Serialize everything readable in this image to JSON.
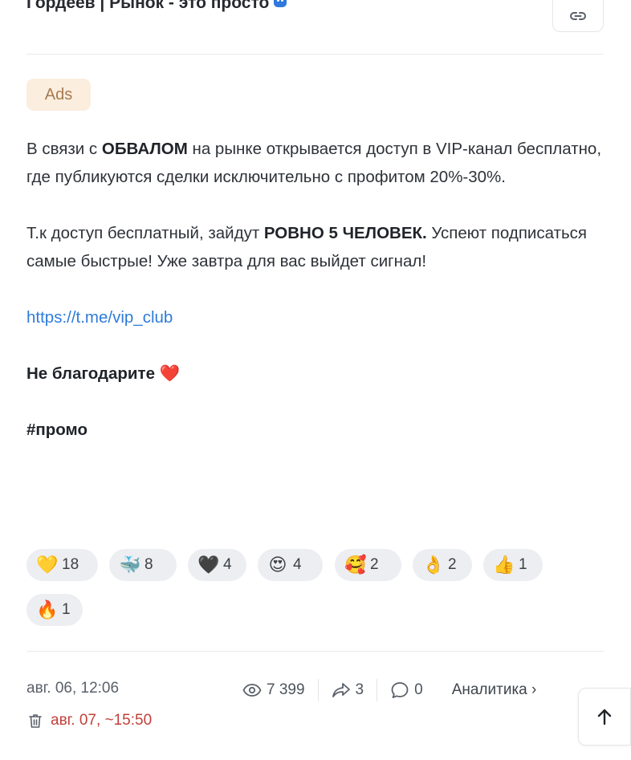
{
  "channel": {
    "title": "Гордеев | Рынок - это просто"
  },
  "ads_badge": "Ads",
  "post": {
    "p1_a": "В связи с ",
    "p1_b": "ОБВАЛОМ",
    "p1_c": " на рынке открывается доступ в VIP-канал бесплатно, где публикуются сделки исключительно с профитом 20%-30%.",
    "p2_a": "Т.к доступ бесплатный, зайдут ",
    "p2_b": "РОВНО 5 ЧЕЛОВЕК.",
    "p2_c": " Успеют подписаться самые быстрые! Уже завтра для вас выйдет сигнал!",
    "link": "https://t.me/vip_club",
    "thanks": "Не благодарите",
    "thanks_emoji": "❤️",
    "hashtag": "#промо"
  },
  "reactions": [
    {
      "emoji": "💛",
      "count": "18"
    },
    {
      "emoji": "🐳",
      "count": "8"
    },
    {
      "emoji": "🖤",
      "count": "4"
    },
    {
      "emoji": "😍",
      "count": "4"
    },
    {
      "emoji": "🥰",
      "count": "2"
    },
    {
      "emoji": "👌",
      "count": "2"
    },
    {
      "emoji": "👍",
      "count": "1"
    },
    {
      "emoji": "🔥",
      "count": "1"
    }
  ],
  "footer": {
    "date": "авг. 06, 12:06",
    "views": "7 399",
    "shares": "3",
    "comments": "0",
    "analytics": "Аналитика ›",
    "delete_date": "авг. 07, ~15:50"
  },
  "colors": {
    "link": "#2f7bd9",
    "accent": "#2f78dd",
    "delete": "#c1403a",
    "ads_bg": "#fbeedf"
  }
}
